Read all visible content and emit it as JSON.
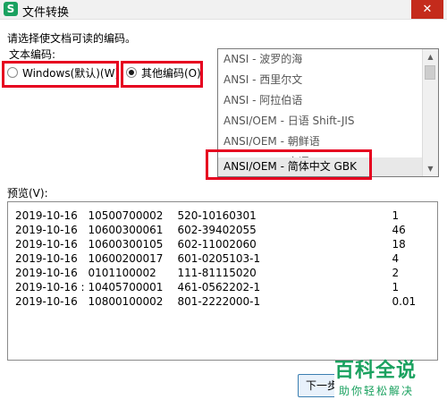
{
  "window": {
    "title": "文件转换",
    "close_glyph": "✕",
    "app_icon_letter": "S"
  },
  "form": {
    "instruction": "请选择使文档可读的编码。",
    "encoding_label": "文本编码:",
    "radio_windows_label": "Windows(默认)(W)",
    "radio_other_label": "其他编码(O)"
  },
  "encoding_list": {
    "items": [
      "ANSI - 波罗的海",
      "ANSI - 西里尔文",
      "ANSI - 阿拉伯语",
      "ANSI/OEM - 日语 Shift-JIS",
      "ANSI/OEM - 朝鲜语",
      "ANSI/OEM - 泰语",
      "ANSI/OEM - 简体中文 GBK"
    ],
    "selected_index": 6
  },
  "preview": {
    "label": "预览(V):",
    "rows": [
      [
        "2019-10-16",
        "10500700002",
        "520-10160301",
        "1"
      ],
      [
        "2019-10-16",
        "10600300061",
        "602-39402055",
        "46"
      ],
      [
        "2019-10-16",
        "10600300105",
        "602-11002060",
        "18"
      ],
      [
        "2019-10-16",
        "10600200017",
        "601-0205103-1",
        "4"
      ],
      [
        "2019-10-16",
        "0101100002",
        "111-81115020",
        "2"
      ],
      [
        "2019-10-16 :",
        "10405700001",
        "461-0562202-1",
        "1"
      ],
      [
        "2019-10-16",
        "10800100002",
        "801-2222000-1",
        "0.01"
      ]
    ]
  },
  "buttons": {
    "next_label": "下一步"
  },
  "watermark": {
    "main": "百科全说",
    "sub": "助你轻松解决"
  },
  "colors": {
    "highlight_red": "#e6001f",
    "brand_green": "#1aa15f"
  }
}
